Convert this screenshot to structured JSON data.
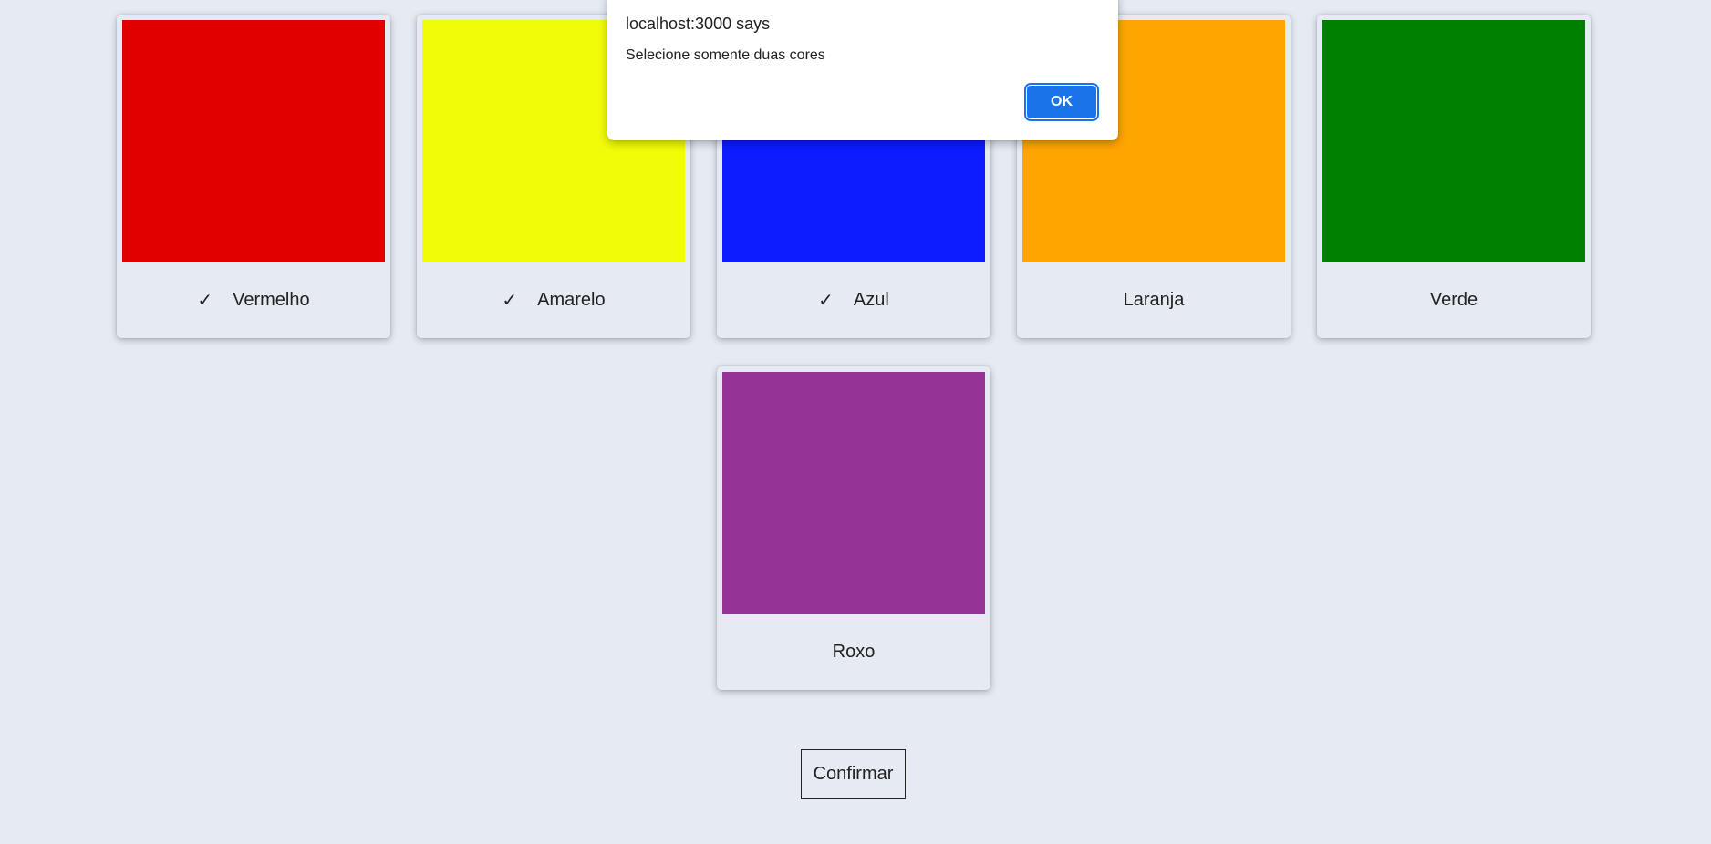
{
  "colors": [
    {
      "label": "Vermelho",
      "hex": "#e00000",
      "selected": true,
      "check_icon": "✓"
    },
    {
      "label": "Amarelo",
      "hex": "#f0fc08",
      "selected": true,
      "check_icon": "✓"
    },
    {
      "label": "Azul",
      "hex": "#0c1cff",
      "selected": true,
      "check_icon": "✓"
    },
    {
      "label": "Laranja",
      "hex": "#ffa500",
      "selected": false
    },
    {
      "label": "Verde",
      "hex": "#008000",
      "selected": false
    },
    {
      "label": "Roxo",
      "hex": "#963396",
      "selected": false
    }
  ],
  "confirm_label": "Confirmar",
  "dialog": {
    "origin": "localhost:3000 says",
    "message": "Selecione somente duas cores",
    "ok_label": "OK",
    "accent": "#1a73e8"
  },
  "theme": {
    "background": "#e6ebf3",
    "text": "#222222"
  }
}
